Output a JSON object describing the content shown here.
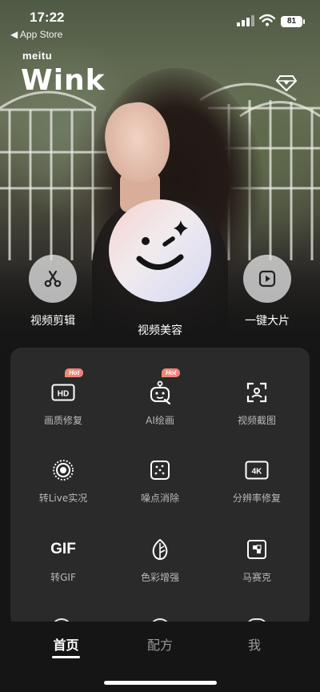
{
  "status_bar": {
    "time": "17:22",
    "back_app": "◀ App Store",
    "battery": "81"
  },
  "brand": {
    "small": "meitu",
    "big": "Wink"
  },
  "quick_actions": [
    {
      "label": "视频剪辑",
      "icon": "scissors-icon"
    },
    {
      "label": "视频美容",
      "icon": "smiley-wink-icon"
    },
    {
      "label": "一键大片",
      "icon": "play-icon"
    }
  ],
  "tools": [
    {
      "label": "画质修复",
      "icon": "hd-icon",
      "badge": "Hot"
    },
    {
      "label": "AI绘画",
      "icon": "ai-robot-icon",
      "badge": "Hot"
    },
    {
      "label": "视频截图",
      "icon": "screenshot-icon",
      "badge": ""
    },
    {
      "label": "转Live实况",
      "icon": "live-icon",
      "badge": ""
    },
    {
      "label": "噪点消除",
      "icon": "denoise-icon",
      "badge": ""
    },
    {
      "label": "分辨率修复",
      "icon": "4k-icon",
      "badge": ""
    },
    {
      "label": "转GIF",
      "icon": "gif-icon",
      "icon_text": "GIF",
      "badge": ""
    },
    {
      "label": "色彩增强",
      "icon": "leaf-icon",
      "badge": ""
    },
    {
      "label": "马赛克",
      "icon": "mosaic-icon",
      "badge": ""
    }
  ],
  "tabs": [
    {
      "label": "首页",
      "active": true
    },
    {
      "label": "配方",
      "active": false
    },
    {
      "label": "我",
      "active": false
    }
  ],
  "colors": {
    "panel": "#2a2a2b",
    "background": "#151515",
    "hot_badge": "#f27f7a"
  }
}
